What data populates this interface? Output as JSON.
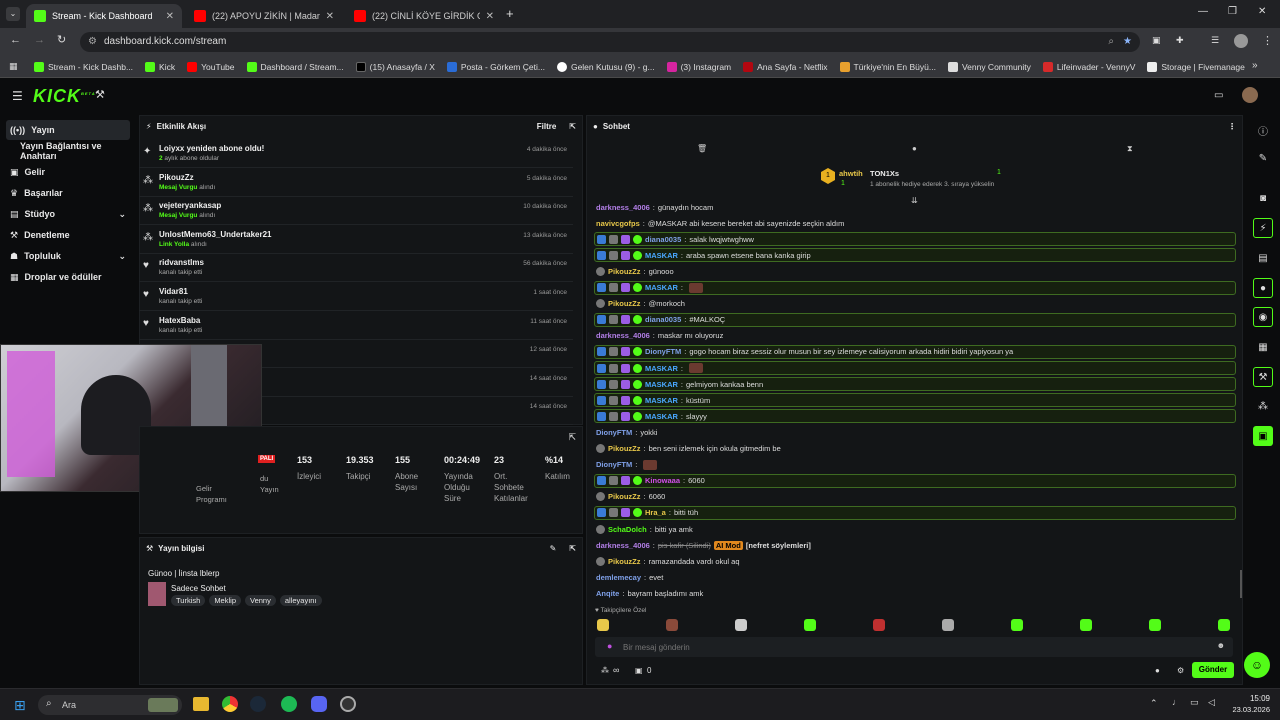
{
  "browser": {
    "tabs": [
      {
        "title": "Stream - Kick Dashboard",
        "color": "#53fc18"
      },
      {
        "title": "(22) APOYU ZİKİN | Madara Ol…",
        "color": "#ff0000"
      },
      {
        "title": "(22) CİNLİ KÖYE GİRDİK GİRME…",
        "color": "#ff0000"
      }
    ],
    "url": "dashboard.kick.com/stream",
    "bookmarks": [
      "Stream - Kick Dashb...",
      "Kick",
      "YouTube",
      "Dashboard / Stream...",
      "(15) Anasayfa / X",
      "Posta - Görkem Çeti...",
      "Gelen Kutusu (9) - g...",
      "(3) Instagram",
      "Ana Sayfa - Netflix",
      "Türkiye'nin En Büyü...",
      "Venny Community",
      "Lifeinvader - VennyV",
      "Storage | Fivemanage"
    ]
  },
  "kick": {
    "logo": "KICK",
    "beta": "BETA"
  },
  "sidebar": {
    "items": [
      "Yayın",
      "Yayın Bağlantısı ve Anahtarı",
      "Gelir",
      "Başarılar",
      "Stüdyo",
      "Denetleme",
      "Topluluk",
      "Droplar ve ödüller"
    ]
  },
  "activity": {
    "title": "Etkinlik Akışı",
    "filter": "Filtre",
    "items": [
      {
        "name": "Loiyxx yeniden abone oldu!",
        "sub_pre": "2",
        "sub": " aylık abone oldular",
        "time": "4 dakika önce"
      },
      {
        "name": "PikouzZz",
        "sub_pre": "Mesaj Vurgu",
        "sub": " alındı",
        "time": "5 dakika önce"
      },
      {
        "name": "vejeteryankasap",
        "sub_pre": "Mesaj Vurgu",
        "sub": " alındı",
        "time": "10 dakika önce"
      },
      {
        "name": "UnlostMemo63_Undertaker21",
        "sub_pre": "Link Yolla",
        "sub": " alındı",
        "time": "13 dakika önce"
      },
      {
        "name": "ridvanstlms",
        "sub_pre": "",
        "sub": "kanalı takip etti",
        "time": "56 dakika önce"
      },
      {
        "name": "Vidar81",
        "sub_pre": "",
        "sub": "kanalı takip etti",
        "time": "1 saat önce"
      },
      {
        "name": "HatexBaba",
        "sub_pre": "",
        "sub": "kanalı takip etti",
        "time": "11 saat önce"
      },
      {
        "name": "",
        "sub_pre": "",
        "sub": "",
        "time": "12 saat önce"
      },
      {
        "name": "",
        "sub_pre": "",
        "sub": "",
        "time": "14 saat önce"
      },
      {
        "name": "",
        "sub_pre": "",
        "sub": "",
        "time": "14 saat önce"
      }
    ]
  },
  "stats": {
    "badge": "PALI",
    "items": [
      {
        "value": "153",
        "label": "İzleyici"
      },
      {
        "value": "19.353",
        "label": "Takipçi"
      },
      {
        "value": "155",
        "label": "Abone Sayısı"
      },
      {
        "value": "00:24:49",
        "label": "Yayında Olduğu Süre"
      },
      {
        "value": "23",
        "label": "Ort. Sohbete Katılanlar"
      },
      {
        "value": "%14",
        "label": "Katılım"
      }
    ],
    "partial_left": [
      "Gelir",
      "Programı"
    ],
    "partial_left2": [
      "du",
      "Yayın"
    ]
  },
  "streaminfo": {
    "title": "Yayın bilgisi",
    "stream_title": "Günoo | İinsta lblerp",
    "category": "Sadece Sohbet",
    "tags": [
      "Turkish",
      "Meklip",
      "Venny",
      "alleyayını"
    ]
  },
  "chat": {
    "title": "Sohbet",
    "pinned": {
      "user": "ahwtih",
      "target": "TON1Xs",
      "count_left": "1",
      "count_right": "1",
      "note": "1 abonelik hediye ederek 3. sıraya yükselin"
    },
    "messages": [
      {
        "user": "darkness_4006",
        "color": "#b37fe8",
        "text": "günaydın hocam",
        "hl": false
      },
      {
        "user": "navivcgofps",
        "color": "#e8c84a",
        "text": "@MASKAR abi kesene bereket abi sayenizde seçkin aldım",
        "hl": false
      },
      {
        "user": "diana0035",
        "color": "#7fa0e8",
        "text": "salak lwqjwtwghww",
        "hl": true
      },
      {
        "user": "MASKAR",
        "color": "#4aa8ff",
        "text": "araba spawn etsene bana kanka girip",
        "hl": true
      },
      {
        "user": "PikouzZz",
        "color": "#e8c84a",
        "text": "günooo",
        "hl": false
      },
      {
        "user": "MASKAR",
        "color": "#4aa8ff",
        "text": "",
        "hl": true
      },
      {
        "user": "PikouzZz",
        "color": "#e8c84a",
        "text": "@morkoch",
        "hl": false
      },
      {
        "user": "diana0035",
        "color": "#7fa0e8",
        "text": "#MALKOÇ",
        "hl": true
      },
      {
        "user": "darkness_4006",
        "color": "#b37fe8",
        "text": "maskar mı oluyoruz",
        "hl": false
      },
      {
        "user": "DionyFTM",
        "color": "#7fa0e8",
        "text": "gogo hocam biraz sessiz olur musun bir sey izlemeye calisiyorum arkada hidiri bidiri yapiyosun ya",
        "hl": true
      },
      {
        "user": "MASKAR",
        "color": "#4aa8ff",
        "text": "",
        "hl": true
      },
      {
        "user": "MASKAR",
        "color": "#4aa8ff",
        "text": "gelmiyom kankaa benn",
        "hl": true
      },
      {
        "user": "MASKAR",
        "color": "#4aa8ff",
        "text": "küstüm",
        "hl": true
      },
      {
        "user": "MASKAR",
        "color": "#4aa8ff",
        "text": "slayyy",
        "hl": true
      },
      {
        "user": "DionyFTM",
        "color": "#7fa0e8",
        "text": "yokki",
        "hl": false
      },
      {
        "user": "PikouzZz",
        "color": "#e8c84a",
        "text": "ben seni izlemek için okula gitmedim be",
        "hl": false
      },
      {
        "user": "DionyFTM",
        "color": "#7fa0e8",
        "text": "",
        "hl": false
      },
      {
        "user": "Kinowaaa",
        "color": "#d14fe8",
        "text": "6060",
        "hl": true
      },
      {
        "user": "PikouzZz",
        "color": "#e8c84a",
        "text": "6060",
        "hl": false
      },
      {
        "user": "Hra_a",
        "color": "#e8c84a",
        "text": "bitti tüh",
        "hl": true
      },
      {
        "user": "SchaDolch",
        "color": "#53fc18",
        "text": "bitti ya amk",
        "hl": false
      },
      {
        "user": "darkness_4006",
        "color": "#b37fe8",
        "text": "pis kafir (Silindi)",
        "hl": false,
        "mod": "AI Mod",
        "mod_text": "[nefret söylemleri]"
      },
      {
        "user": "PikouzZz",
        "color": "#e8c84a",
        "text": "ramazandada vardı okul aq",
        "hl": false
      },
      {
        "user": "demlemecay",
        "color": "#7fa0e8",
        "text": "evet",
        "hl": false
      },
      {
        "user": "Anqite",
        "color": "#7fa0e8",
        "text": "bayram başladımı amk",
        "hl": false
      }
    ],
    "followers_only": "Takipçilere Özel",
    "placeholder": "Bir mesaj gönderin",
    "send": "Gönder",
    "bottom_count": "0",
    "infinity": "∞"
  },
  "taskbar": {
    "search": "Ara",
    "time": "15:09",
    "date": "23.03.2026"
  }
}
